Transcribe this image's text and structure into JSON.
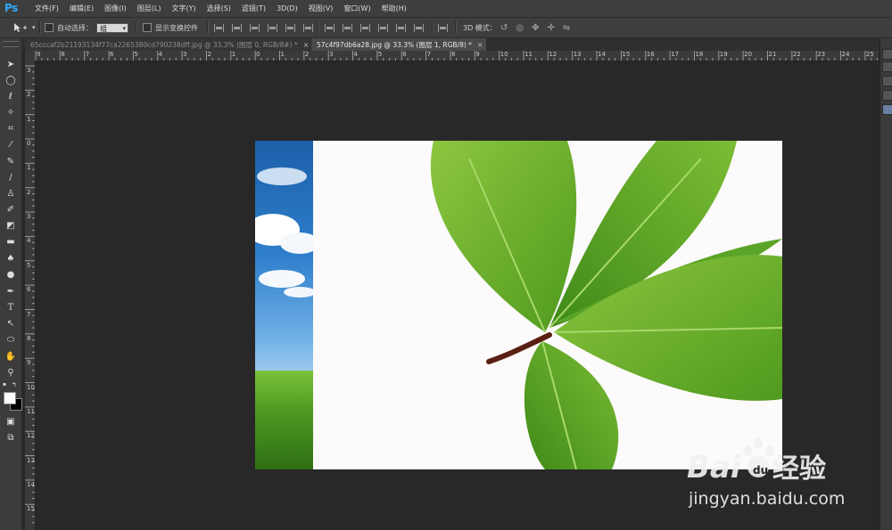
{
  "app": {
    "logo": "Ps"
  },
  "menus": [
    "文件(F)",
    "编辑(E)",
    "图像(I)",
    "图层(L)",
    "文字(Y)",
    "选择(S)",
    "滤镜(T)",
    "3D(D)",
    "视图(V)",
    "窗口(W)",
    "帮助(H)"
  ],
  "options": {
    "auto_select_label": "自动选择：",
    "auto_select_value": "组",
    "show_transform_label": "显示变换控件",
    "mode_3d_label": "3D 模式："
  },
  "tabs": [
    {
      "label": "65cccaf2b21193134f77ca2265380cd790238dff.jpg @ 33.3% (图层 0, RGB/8#) *",
      "close": "×"
    },
    {
      "label": "57c4f97db6a28.jpg @ 33.3% (图层 1, RGB/8) *",
      "close": "×"
    }
  ],
  "ruler_h": [
    "9",
    "8",
    "7",
    "6",
    "5",
    "4",
    "3",
    "2",
    "1",
    "0",
    "1",
    "2",
    "3",
    "4",
    "5",
    "6",
    "7",
    "8",
    "9",
    "10",
    "11",
    "12",
    "13",
    "14",
    "15",
    "16",
    "17",
    "18",
    "19",
    "20",
    "21",
    "22",
    "23",
    "24",
    "25"
  ],
  "ruler_v": [
    "3",
    "2",
    "1",
    "0",
    "1",
    "2",
    "3",
    "4",
    "5",
    "6",
    "7",
    "8",
    "9",
    "10",
    "11",
    "12",
    "13",
    "14",
    "15"
  ],
  "tools": [
    "move-tool",
    "marquee-tool",
    "lasso-tool",
    "magic-wand-tool",
    "crop-tool",
    "eyedropper-tool",
    "healing-brush-tool",
    "brush-tool",
    "clone-stamp-tool",
    "history-brush-tool",
    "eraser-tool",
    "gradient-tool",
    "blur-tool",
    "dodge-tool",
    "pen-tool",
    "type-tool",
    "path-selection-tool",
    "shape-tool",
    "hand-tool",
    "zoom-tool"
  ],
  "watermark": {
    "brand": "Bai",
    "brand2": "du",
    "cn": "经验",
    "url": "jingyan.baidu.com"
  }
}
